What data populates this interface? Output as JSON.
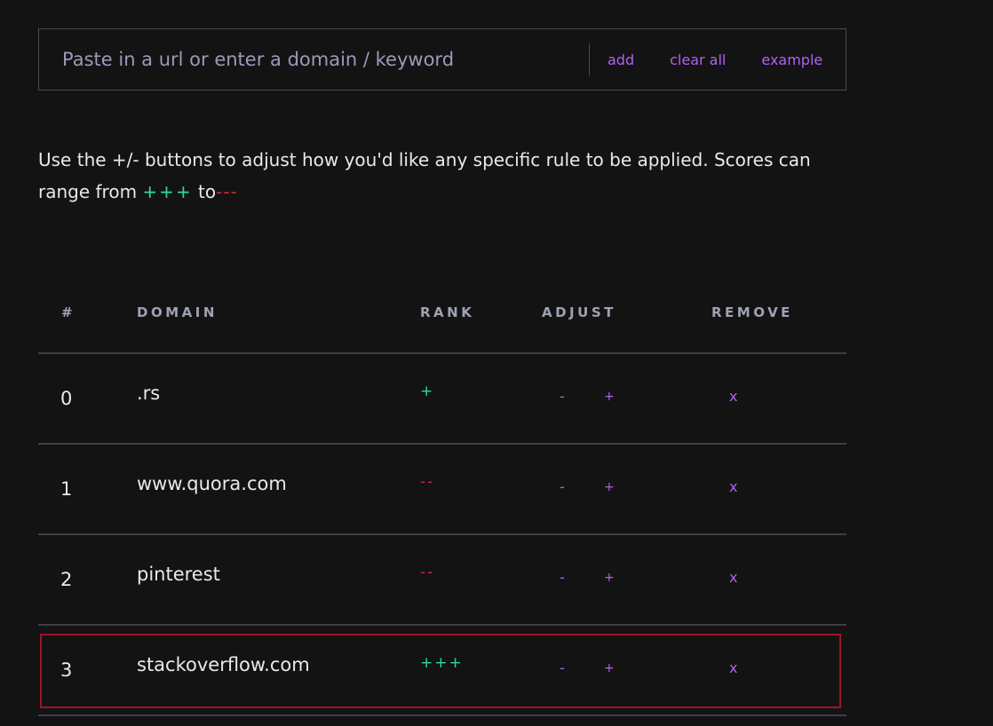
{
  "search": {
    "placeholder": "Paste in a url or enter a domain / keyword",
    "value": "",
    "add_label": "add",
    "clear_label": "clear all",
    "example_label": "example"
  },
  "intro": {
    "text_before": "Use the +/- buttons to adjust how you'd like any specific rule to be applied. Scores can range from ",
    "max_symbol": "+++",
    "middle": " to",
    "min_symbol": "---"
  },
  "table": {
    "headers": {
      "num": "#",
      "domain": "DOMAIN",
      "rank": "RANK",
      "adjust": "ADJUST",
      "remove": "REMOVE"
    },
    "rows": [
      {
        "num": "0",
        "domain": ".rs",
        "rank": "+",
        "rank_type": "positive",
        "minus": "-",
        "plus": "+",
        "remove": "x"
      },
      {
        "num": "1",
        "domain": "www.quora.com",
        "rank": "--",
        "rank_type": "negative",
        "minus": "-",
        "plus": "+",
        "remove": "x"
      },
      {
        "num": "2",
        "domain": "pinterest",
        "rank": "--",
        "rank_type": "negative",
        "minus": "-",
        "plus": "+",
        "remove": "x"
      },
      {
        "num": "3",
        "domain": "stackoverflow.com",
        "rank": "+++",
        "rank_type": "positive",
        "minus": "-",
        "plus": "+",
        "remove": "x",
        "highlighted": true
      }
    ]
  },
  "colors": {
    "background": "#131314",
    "accent": "#b061f0",
    "positive": "#2fd89a",
    "negative": "#d7263d",
    "highlight_border": "#a3122a"
  }
}
